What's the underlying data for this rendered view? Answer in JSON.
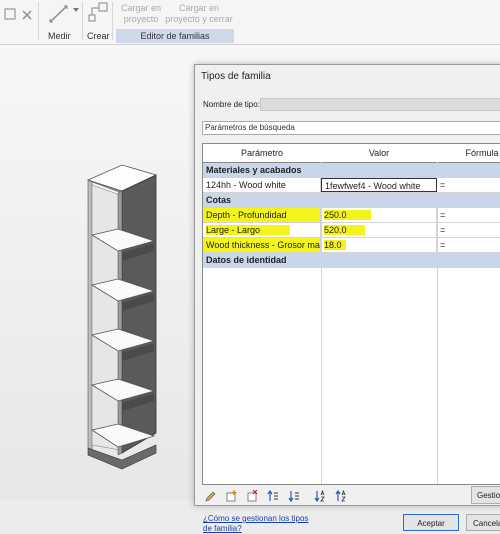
{
  "ribbon": {
    "measure_label": "Medir",
    "create_label": "Crear",
    "load_into_project": "Cargar en\nproyecto",
    "load_into_project_close": "Cargar en\nproyecto y cerrar",
    "panel_label": "Editor de familias",
    "icons": [
      "delete-x-icon",
      "measure-ruler-icon",
      "create-component-icon"
    ]
  },
  "dialog": {
    "title": "Tipos de familia",
    "type_name_label": "Nombre de tipo:",
    "type_name_value": "",
    "search_placeholder": "Parámetros de búsqueda",
    "columns": [
      "Parámetro",
      "Valor",
      "Fórmula"
    ],
    "groups": [
      {
        "label": "Materiales y acabados",
        "rows": [
          {
            "param": "124hh - Wood white",
            "value": "1fewfwef4 - Wood white",
            "formula": "=",
            "highlight": false
          }
        ]
      },
      {
        "label": "Cotas",
        "rows": [
          {
            "param": "Depth - Profundidad",
            "value": "250.0",
            "formula": "=",
            "highlight": true
          },
          {
            "param": "Large - Largo",
            "value": "520.0",
            "formula": "=",
            "highlight": true
          },
          {
            "param": "Wood thickness - Grosor ma",
            "value": "18.0",
            "formula": "=",
            "highlight": true
          }
        ]
      },
      {
        "label": "Datos de identidad",
        "rows": []
      }
    ],
    "toolbar_icons": [
      "edit-pencil-icon",
      "new-parameter-icon",
      "delete-parameter-icon",
      "move-up-icon",
      "move-down-icon",
      "sort-ascending-icon",
      "sort-descending-icon"
    ],
    "manage_button": "Gestionar",
    "help_link": "¿Cómo se gestionan los tipos\nde familia?",
    "ok_button": "Aceptar",
    "cancel_button": "Cancelar",
    "highlight_color": "#f4f41c"
  }
}
